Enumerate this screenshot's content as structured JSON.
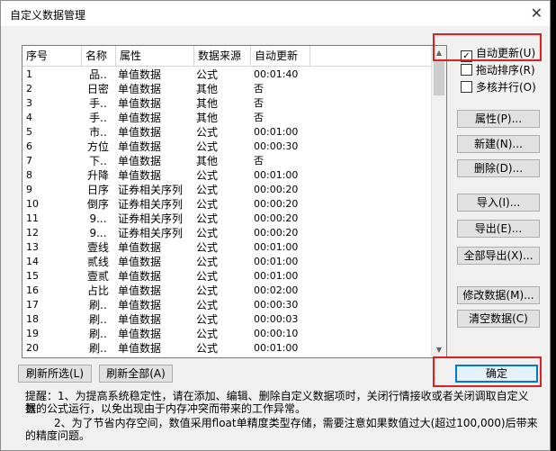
{
  "window": {
    "title": "自定义数据管理",
    "close_glyph": "✕"
  },
  "list": {
    "columns": [
      "序号",
      "名称",
      "属性",
      "数据来源",
      "自动更新"
    ],
    "rows": [
      [
        "1",
        "品..",
        "单值数据",
        "公式",
        "00:01:40"
      ],
      [
        "2",
        "日密",
        "单值数据",
        "其他",
        "否"
      ],
      [
        "3",
        "手..",
        "单值数据",
        "其他",
        "否"
      ],
      [
        "4",
        "手..",
        "单值数据",
        "其他",
        "否"
      ],
      [
        "5",
        "市..",
        "单值数据",
        "公式",
        "00:01:00"
      ],
      [
        "6",
        "方位",
        "单值数据",
        "公式",
        "00:00:30"
      ],
      [
        "7",
        "下..",
        "单值数据",
        "其他",
        "否"
      ],
      [
        "8",
        "升降",
        "单值数据",
        "公式",
        "00:01:00"
      ],
      [
        "9",
        "日序",
        "证券相关序列",
        "公式",
        "00:00:20"
      ],
      [
        "10",
        "倒序",
        "证券相关序列",
        "公式",
        "00:00:20"
      ],
      [
        "11",
        "9...",
        "证券相关序列",
        "公式",
        "00:00:20"
      ],
      [
        "12",
        "9...",
        "证券相关序列",
        "公式",
        "00:00:20"
      ],
      [
        "13",
        "壹线",
        "单值数据",
        "公式",
        "00:01:00"
      ],
      [
        "14",
        "贰线",
        "单值数据",
        "公式",
        "00:01:00"
      ],
      [
        "15",
        "壹贰",
        "单值数据",
        "公式",
        "00:01:00"
      ],
      [
        "16",
        "占比",
        "单值数据",
        "公式",
        "00:02:00"
      ],
      [
        "17",
        "刷..",
        "单值数据",
        "公式",
        "00:00:30"
      ],
      [
        "18",
        "刷..",
        "单值数据",
        "公式",
        "00:00:03"
      ],
      [
        "19",
        "刷..",
        "单值数据",
        "公式",
        "00:00:10"
      ],
      [
        "20",
        "刷..",
        "单值数据",
        "公式",
        "00:01:00"
      ]
    ]
  },
  "options": {
    "auto_update": {
      "label": "自动更新(U)",
      "checked": true
    },
    "drag_sort": {
      "label": "拖动排序(R)",
      "checked": false
    },
    "multicore": {
      "label": "多核并行(O)",
      "checked": false
    }
  },
  "buttons": {
    "properties": "属性(P)...",
    "new": "新建(N)...",
    "delete": "删除(D)...",
    "import": "导入(I)...",
    "export": "导出(E)...",
    "export_all": "全部导出(X)...",
    "modify_data": "修改数据(M)...",
    "clear_data": "清空数据(C)",
    "refresh_selected": "刷新所选(L)",
    "refresh_all": "刷新全部(A)",
    "ok": "确定"
  },
  "tips": {
    "line1": "提醒：1、为提高系统稳定性，请在添加、编辑、删除自定义数据项时，关闭行情接收或者关闭调取自定义数",
    "line2": "据的公式运行，以免出现由于内存冲突而带来的工作异常。",
    "line3": "2、为了节省内存空间，数值采用float单精度类型存储，需要注意如果数值过大(超过100,000)后带来",
    "line4": "的精度问题。"
  },
  "colors": {
    "highlight": "#e02020",
    "focus": "#0078d7"
  }
}
